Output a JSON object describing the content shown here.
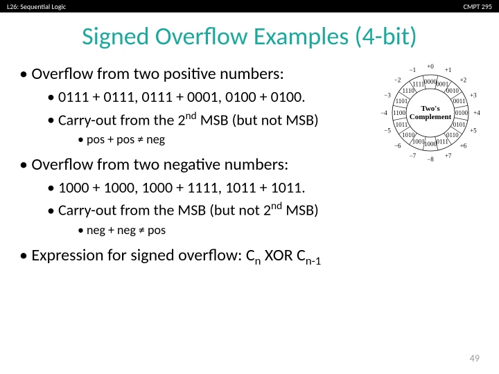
{
  "header": {
    "left": "L26: Sequential Logic",
    "right": "CMPT 295"
  },
  "title": "Signed Overflow Examples (4-bit)",
  "bullets": {
    "b1": "Overflow from two positive numbers:",
    "b1a": "0111 + 0111, 0111 + 0001, 0100 + 0100.",
    "b1b_pre": "Carry-out from the 2",
    "b1b_sup": "nd",
    "b1b_post": " MSB (but not MSB)",
    "b1c": "pos + pos ≠ neg",
    "b2": "Overflow from two negative numbers:",
    "b2a": "1000 + 1000, 1000 + 1111, 1011 + 1011.",
    "b2b_pre": "Carry-out from the MSB (but not 2",
    "b2b_sup": "nd",
    "b2b_post": " MSB)",
    "b2c": "neg + neg ≠ pos",
    "b3_pre": "Expression for signed overflow: C",
    "b3_sub1": "n",
    "b3_mid": " XOR C",
    "b3_sub2": "n-1"
  },
  "slidenum": "49",
  "wheel": {
    "center1": "Two's",
    "center2": "Complement",
    "slots": [
      {
        "bin": "0000",
        "dec": "+0"
      },
      {
        "bin": "0001",
        "dec": "+1"
      },
      {
        "bin": "0010",
        "dec": "+2"
      },
      {
        "bin": "0011",
        "dec": "+3"
      },
      {
        "bin": "0100",
        "dec": "+4"
      },
      {
        "bin": "0101",
        "dec": "+5"
      },
      {
        "bin": "0110",
        "dec": "+6"
      },
      {
        "bin": "0111",
        "dec": "+7"
      },
      {
        "bin": "1000",
        "dec": "−8"
      },
      {
        "bin": "1001",
        "dec": "−7"
      },
      {
        "bin": "1010",
        "dec": "−6"
      },
      {
        "bin": "1011",
        "dec": "−5"
      },
      {
        "bin": "1100",
        "dec": "−4"
      },
      {
        "bin": "1101",
        "dec": "−3"
      },
      {
        "bin": "1110",
        "dec": "−2"
      },
      {
        "bin": "1111",
        "dec": "−1"
      }
    ]
  }
}
